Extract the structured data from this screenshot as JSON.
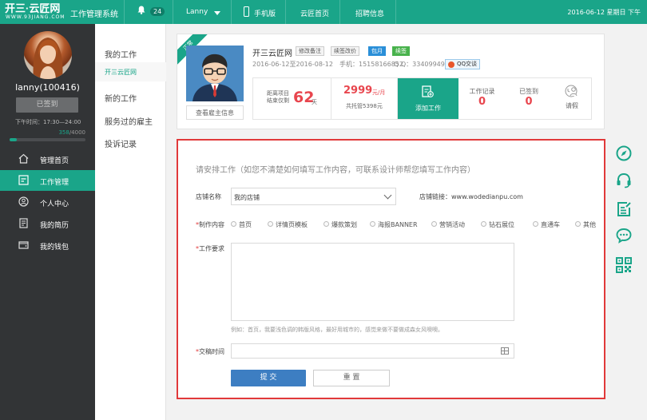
{
  "topbar": {
    "logo_text": "开三·云匠网",
    "logo_sub": "WWW.93JIANG.COM",
    "system_title": "工作管理系统",
    "notification_count": "24",
    "username": "Lanny",
    "nav": [
      "手机版",
      "云匠首页",
      "招聘信息"
    ],
    "date": "2016-06-12 星期日 下午"
  },
  "sidebar": {
    "user_display": "lanny(100416)",
    "signed_button": "已签到",
    "off_time": "下午时间：17:30—24:00",
    "progress_current": "358",
    "progress_total": "/4000",
    "progress_fraction": 0.0895,
    "menu": [
      {
        "label": "管理首页",
        "icon": "home-icon"
      },
      {
        "label": "工作管理",
        "icon": "work-manage-icon"
      },
      {
        "label": "个人中心",
        "icon": "user-center-icon"
      },
      {
        "label": "我的简历",
        "icon": "resume-icon"
      },
      {
        "label": "我的钱包",
        "icon": "wallet-icon"
      }
    ],
    "active_index": 1
  },
  "submenu": {
    "my_work": "我的工作",
    "current_shop": "开三云匠网",
    "new_work": "新的工作",
    "served_employers": "服务过的雇主",
    "complaints": "投诉记录"
  },
  "employer_card": {
    "ribbon": "正常",
    "view_button": "查看雇主信息",
    "name": "开三云匠网",
    "tags": {
      "edit_remark": "修改备注",
      "renew_change": "续签改价",
      "monthly": "包月",
      "renewed": "续签"
    },
    "period": "2016-06-12至2016-08-12",
    "phone": "手机：15158166852",
    "qq": "Q Q：3340994903",
    "qq_chat": "QQ交谈",
    "stats": {
      "remaining_label1": "距离项目",
      "remaining_label2": "结束仅剩",
      "remaining_days": "62",
      "days_unit": "天",
      "price": "2999",
      "price_unit": "元/月",
      "total_deposit": "共托管5398元",
      "add_work": "添加工作",
      "work_records_label": "工作记录",
      "work_records": "0",
      "signed_label": "已签到",
      "signed": "0",
      "leave_label": "请假"
    }
  },
  "form": {
    "title": "请安排工作（如您不清楚如何填写工作内容，可联系设计师帮您填写工作内容）",
    "shop_label": "店铺名称",
    "shop_value": "我的店铺",
    "shop_link_label": "店铺链接：www.wodedianpu.com",
    "content_label": "制作内容",
    "required_mark": "*",
    "options": [
      "首页",
      "详情页模板",
      "爆款策划",
      "海报BANNER",
      "营销活动",
      "钻石展位",
      "直通车",
      "其他"
    ],
    "requirement_label": "工作要求",
    "example": "例如：首页，我要浅色调的韩版风格，最好用城市的，感觉来做不要做成森女风噢噢。",
    "deadline_label": "交稿时间",
    "submit": "提 交",
    "reset": "重 置"
  },
  "right_tools": [
    "compass-icon",
    "headset-icon",
    "edit-list-icon",
    "chat-bubble-icon",
    "qrcode-icon"
  ],
  "colors": {
    "accent": "#1aa589",
    "sidebar": "#323436",
    "alert_border": "#e1393a",
    "submit": "#3d7ec2"
  }
}
